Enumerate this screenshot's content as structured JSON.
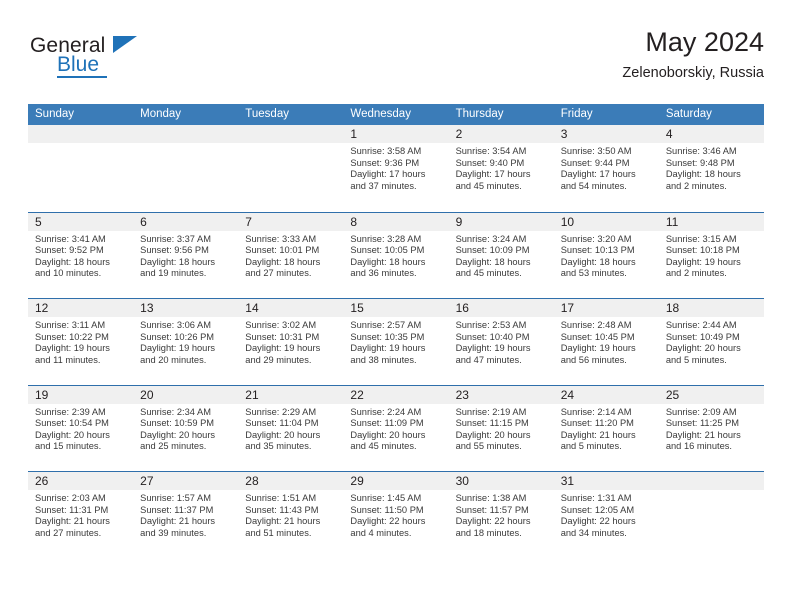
{
  "brand": {
    "name_top": "General",
    "name_bottom": "Blue",
    "accent_color": "#1f72b8"
  },
  "header": {
    "title": "May 2024",
    "subtitle": "Zelenoborskiy, Russia"
  },
  "calendar": {
    "header_bg": "#3b7cb8",
    "row_divider_color": "#2f6fab",
    "daynum_bg": "#f0f0f0",
    "weekdays": [
      "Sunday",
      "Monday",
      "Tuesday",
      "Wednesday",
      "Thursday",
      "Friday",
      "Saturday"
    ],
    "weeks": [
      [
        {
          "day": "",
          "empty": true,
          "sunrise": "",
          "sunset": "",
          "daylight1": "",
          "daylight2": ""
        },
        {
          "day": "",
          "empty": true,
          "sunrise": "",
          "sunset": "",
          "daylight1": "",
          "daylight2": ""
        },
        {
          "day": "",
          "empty": true,
          "sunrise": "",
          "sunset": "",
          "daylight1": "",
          "daylight2": ""
        },
        {
          "day": "1",
          "empty": false,
          "sunrise": "Sunrise: 3:58 AM",
          "sunset": "Sunset: 9:36 PM",
          "daylight1": "Daylight: 17 hours",
          "daylight2": "and 37 minutes."
        },
        {
          "day": "2",
          "empty": false,
          "sunrise": "Sunrise: 3:54 AM",
          "sunset": "Sunset: 9:40 PM",
          "daylight1": "Daylight: 17 hours",
          "daylight2": "and 45 minutes."
        },
        {
          "day": "3",
          "empty": false,
          "sunrise": "Sunrise: 3:50 AM",
          "sunset": "Sunset: 9:44 PM",
          "daylight1": "Daylight: 17 hours",
          "daylight2": "and 54 minutes."
        },
        {
          "day": "4",
          "empty": false,
          "sunrise": "Sunrise: 3:46 AM",
          "sunset": "Sunset: 9:48 PM",
          "daylight1": "Daylight: 18 hours",
          "daylight2": "and 2 minutes."
        }
      ],
      [
        {
          "day": "5",
          "empty": false,
          "sunrise": "Sunrise: 3:41 AM",
          "sunset": "Sunset: 9:52 PM",
          "daylight1": "Daylight: 18 hours",
          "daylight2": "and 10 minutes."
        },
        {
          "day": "6",
          "empty": false,
          "sunrise": "Sunrise: 3:37 AM",
          "sunset": "Sunset: 9:56 PM",
          "daylight1": "Daylight: 18 hours",
          "daylight2": "and 19 minutes."
        },
        {
          "day": "7",
          "empty": false,
          "sunrise": "Sunrise: 3:33 AM",
          "sunset": "Sunset: 10:01 PM",
          "daylight1": "Daylight: 18 hours",
          "daylight2": "and 27 minutes."
        },
        {
          "day": "8",
          "empty": false,
          "sunrise": "Sunrise: 3:28 AM",
          "sunset": "Sunset: 10:05 PM",
          "daylight1": "Daylight: 18 hours",
          "daylight2": "and 36 minutes."
        },
        {
          "day": "9",
          "empty": false,
          "sunrise": "Sunrise: 3:24 AM",
          "sunset": "Sunset: 10:09 PM",
          "daylight1": "Daylight: 18 hours",
          "daylight2": "and 45 minutes."
        },
        {
          "day": "10",
          "empty": false,
          "sunrise": "Sunrise: 3:20 AM",
          "sunset": "Sunset: 10:13 PM",
          "daylight1": "Daylight: 18 hours",
          "daylight2": "and 53 minutes."
        },
        {
          "day": "11",
          "empty": false,
          "sunrise": "Sunrise: 3:15 AM",
          "sunset": "Sunset: 10:18 PM",
          "daylight1": "Daylight: 19 hours",
          "daylight2": "and 2 minutes."
        }
      ],
      [
        {
          "day": "12",
          "empty": false,
          "sunrise": "Sunrise: 3:11 AM",
          "sunset": "Sunset: 10:22 PM",
          "daylight1": "Daylight: 19 hours",
          "daylight2": "and 11 minutes."
        },
        {
          "day": "13",
          "empty": false,
          "sunrise": "Sunrise: 3:06 AM",
          "sunset": "Sunset: 10:26 PM",
          "daylight1": "Daylight: 19 hours",
          "daylight2": "and 20 minutes."
        },
        {
          "day": "14",
          "empty": false,
          "sunrise": "Sunrise: 3:02 AM",
          "sunset": "Sunset: 10:31 PM",
          "daylight1": "Daylight: 19 hours",
          "daylight2": "and 29 minutes."
        },
        {
          "day": "15",
          "empty": false,
          "sunrise": "Sunrise: 2:57 AM",
          "sunset": "Sunset: 10:35 PM",
          "daylight1": "Daylight: 19 hours",
          "daylight2": "and 38 minutes."
        },
        {
          "day": "16",
          "empty": false,
          "sunrise": "Sunrise: 2:53 AM",
          "sunset": "Sunset: 10:40 PM",
          "daylight1": "Daylight: 19 hours",
          "daylight2": "and 47 minutes."
        },
        {
          "day": "17",
          "empty": false,
          "sunrise": "Sunrise: 2:48 AM",
          "sunset": "Sunset: 10:45 PM",
          "daylight1": "Daylight: 19 hours",
          "daylight2": "and 56 minutes."
        },
        {
          "day": "18",
          "empty": false,
          "sunrise": "Sunrise: 2:44 AM",
          "sunset": "Sunset: 10:49 PM",
          "daylight1": "Daylight: 20 hours",
          "daylight2": "and 5 minutes."
        }
      ],
      [
        {
          "day": "19",
          "empty": false,
          "sunrise": "Sunrise: 2:39 AM",
          "sunset": "Sunset: 10:54 PM",
          "daylight1": "Daylight: 20 hours",
          "daylight2": "and 15 minutes."
        },
        {
          "day": "20",
          "empty": false,
          "sunrise": "Sunrise: 2:34 AM",
          "sunset": "Sunset: 10:59 PM",
          "daylight1": "Daylight: 20 hours",
          "daylight2": "and 25 minutes."
        },
        {
          "day": "21",
          "empty": false,
          "sunrise": "Sunrise: 2:29 AM",
          "sunset": "Sunset: 11:04 PM",
          "daylight1": "Daylight: 20 hours",
          "daylight2": "and 35 minutes."
        },
        {
          "day": "22",
          "empty": false,
          "sunrise": "Sunrise: 2:24 AM",
          "sunset": "Sunset: 11:09 PM",
          "daylight1": "Daylight: 20 hours",
          "daylight2": "and 45 minutes."
        },
        {
          "day": "23",
          "empty": false,
          "sunrise": "Sunrise: 2:19 AM",
          "sunset": "Sunset: 11:15 PM",
          "daylight1": "Daylight: 20 hours",
          "daylight2": "and 55 minutes."
        },
        {
          "day": "24",
          "empty": false,
          "sunrise": "Sunrise: 2:14 AM",
          "sunset": "Sunset: 11:20 PM",
          "daylight1": "Daylight: 21 hours",
          "daylight2": "and 5 minutes."
        },
        {
          "day": "25",
          "empty": false,
          "sunrise": "Sunrise: 2:09 AM",
          "sunset": "Sunset: 11:25 PM",
          "daylight1": "Daylight: 21 hours",
          "daylight2": "and 16 minutes."
        }
      ],
      [
        {
          "day": "26",
          "empty": false,
          "sunrise": "Sunrise: 2:03 AM",
          "sunset": "Sunset: 11:31 PM",
          "daylight1": "Daylight: 21 hours",
          "daylight2": "and 27 minutes."
        },
        {
          "day": "27",
          "empty": false,
          "sunrise": "Sunrise: 1:57 AM",
          "sunset": "Sunset: 11:37 PM",
          "daylight1": "Daylight: 21 hours",
          "daylight2": "and 39 minutes."
        },
        {
          "day": "28",
          "empty": false,
          "sunrise": "Sunrise: 1:51 AM",
          "sunset": "Sunset: 11:43 PM",
          "daylight1": "Daylight: 21 hours",
          "daylight2": "and 51 minutes."
        },
        {
          "day": "29",
          "empty": false,
          "sunrise": "Sunrise: 1:45 AM",
          "sunset": "Sunset: 11:50 PM",
          "daylight1": "Daylight: 22 hours",
          "daylight2": "and 4 minutes."
        },
        {
          "day": "30",
          "empty": false,
          "sunrise": "Sunrise: 1:38 AM",
          "sunset": "Sunset: 11:57 PM",
          "daylight1": "Daylight: 22 hours",
          "daylight2": "and 18 minutes."
        },
        {
          "day": "31",
          "empty": false,
          "sunrise": "Sunrise: 1:31 AM",
          "sunset": "Sunset: 12:05 AM",
          "daylight1": "Daylight: 22 hours",
          "daylight2": "and 34 minutes."
        },
        {
          "day": "",
          "empty": true,
          "sunrise": "",
          "sunset": "",
          "daylight1": "",
          "daylight2": ""
        }
      ]
    ]
  }
}
